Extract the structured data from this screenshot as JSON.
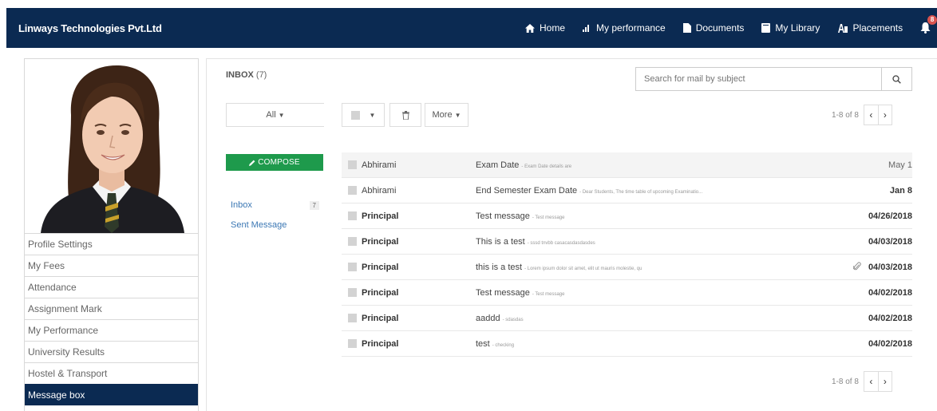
{
  "app": {
    "brand": "Linways Technologies Pvt.Ltd"
  },
  "nav": {
    "items": [
      {
        "label": "Home",
        "icon": "home-icon"
      },
      {
        "label": "My performance",
        "icon": "bar-chart-icon"
      },
      {
        "label": "Documents",
        "icon": "document-icon"
      },
      {
        "label": "My Library",
        "icon": "book-icon"
      },
      {
        "label": "Placements",
        "icon": "placement-icon"
      }
    ],
    "notification_count": "8"
  },
  "sidebar": {
    "items": [
      {
        "label": "Profile Settings"
      },
      {
        "label": "My Fees"
      },
      {
        "label": "Attendance"
      },
      {
        "label": "Assignment Mark"
      },
      {
        "label": "My Performance"
      },
      {
        "label": "University Results"
      },
      {
        "label": "Hostel & Transport"
      },
      {
        "label": "Message box",
        "active": true
      }
    ]
  },
  "inbox": {
    "title": "INBOX",
    "count": "(7)",
    "search_placeholder": "Search for mail by subject",
    "filter_label": "All",
    "more_label": "More",
    "pager_text": "1-8 of 8",
    "compose_label": "COMPOSE",
    "folders": {
      "inbox_label": "Inbox",
      "inbox_count": "7",
      "sent_label": "Sent Message"
    },
    "messages": [
      {
        "sender": "Abhirami",
        "subject": "Exam Date",
        "preview": "- Exam Date details are",
        "date": "May 1",
        "unread": false
      },
      {
        "sender": "Abhirami",
        "subject": "End Semester Exam Date",
        "preview": "- Dear Students, The time table of upcoming Examinatio...",
        "date": "Jan 8",
        "unread": false
      },
      {
        "sender": "Principal",
        "subject": "Test message",
        "preview": "- Test message",
        "date": "04/26/2018",
        "unread": true
      },
      {
        "sender": "Principal",
        "subject": "This is a test",
        "preview": "- sssd tnvbb casacasdasdasdes",
        "date": "04/03/2018",
        "unread": true
      },
      {
        "sender": "Principal",
        "subject": "this is a test",
        "preview": "- Lorem ipsum dolor sit amet, elit ut mauris molestie, qu",
        "date": "04/03/2018",
        "unread": true
      },
      {
        "sender": "Principal",
        "subject": "Test message",
        "preview": "- Test message",
        "date": "04/02/2018",
        "unread": true
      },
      {
        "sender": "Principal",
        "subject": "aaddd",
        "preview": "- sdasdas",
        "date": "04/02/2018",
        "unread": true
      },
      {
        "sender": "Principal",
        "subject": "test",
        "preview": "- checking",
        "date": "04/02/2018",
        "unread": true
      }
    ]
  }
}
